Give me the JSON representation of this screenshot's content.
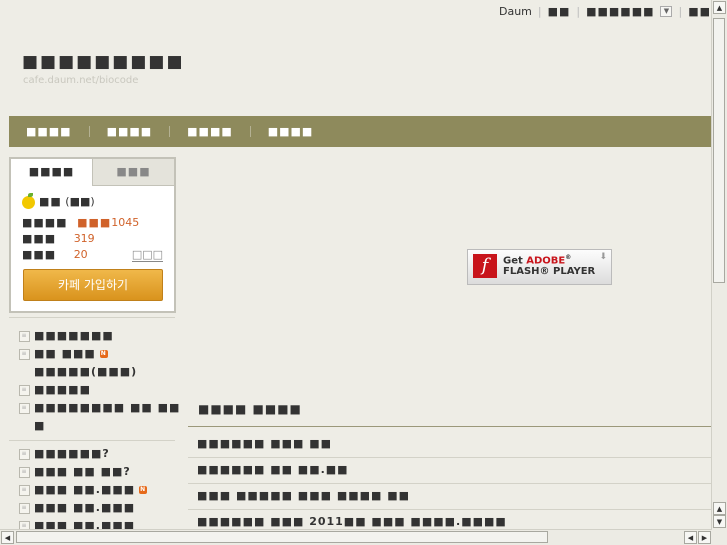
{
  "topbar": {
    "daum": "Daum",
    "link1": "■■",
    "link2": "■■■■■■",
    "link3": "■■"
  },
  "header": {
    "title": "■■■■■■■■■",
    "url": "cafe.daum.net/biocode"
  },
  "menu": [
    "■■■■",
    "■■■■",
    "■■■■",
    "■■■■"
  ],
  "profile": {
    "tab1": "■■■■",
    "tab2": "■■■",
    "row1_name": "■■",
    "row1_paren": "(■■)",
    "row2_label": "■■■■",
    "row2_key": "■■■",
    "row2_value": "1045",
    "row3_label": "■■■",
    "row3_value": "319",
    "row4_label": "■■■",
    "row4_value": "20",
    "row4_link": "□□□",
    "join_button": "카페 가입하기"
  },
  "menu_list1": [
    {
      "label": "■■■■■■■",
      "new": false
    },
    {
      "label": "■■ ■■■",
      "new": true
    },
    {
      "label": "■■■■■(■■■)",
      "new": false,
      "indent": true
    },
    {
      "label": "■■■■■",
      "new": false
    },
    {
      "label": "■■■■■■■■ ■■ ■■",
      "new": false
    },
    {
      "label": "■",
      "new": false,
      "indent": true
    }
  ],
  "menu_list2": [
    {
      "label": "■■■■■■?",
      "new": false
    },
    {
      "label": "■■■ ■■ ■■?",
      "new": false
    },
    {
      "label": "■■■ ■■.■■■",
      "new": true
    },
    {
      "label": "■■■ ■■.■■■",
      "new": false
    },
    {
      "label": "■■■ ■■.■■■",
      "new": false
    }
  ],
  "new_badge": "N",
  "flash": {
    "get": "Get",
    "adobe": "ADOBE",
    "reg": "®",
    "flash_player": "FLASH® PLAYER"
  },
  "board": {
    "title": "■■■■ ■■■■",
    "posts": [
      "■■■■■■ ■■■ ■■",
      "■■■■■■ ■■ ■■.■■",
      "■■■ ■■■■■ ■■■ ■■■■ ■■",
      "■■■■■■ ■■■ 2011■■ ■■■ ■■■■.■■■■"
    ]
  }
}
